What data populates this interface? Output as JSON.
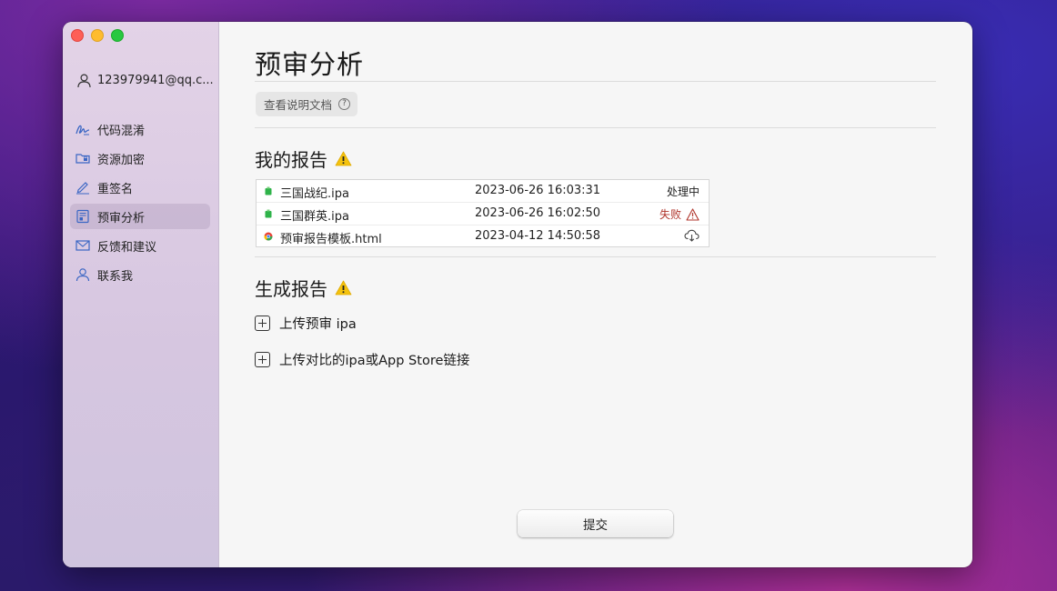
{
  "sidebar": {
    "account": "123979941@qq.c...",
    "items": [
      {
        "label": "代码混淆",
        "icon": "signature-icon"
      },
      {
        "label": "资源加密",
        "icon": "folder-lock-icon"
      },
      {
        "label": "重签名",
        "icon": "pencil-icon"
      },
      {
        "label": "预审分析",
        "icon": "document-icon",
        "active": true
      },
      {
        "label": "反馈和建议",
        "icon": "envelope-icon"
      },
      {
        "label": "联系我",
        "icon": "person-icon"
      }
    ]
  },
  "main": {
    "title": "预审分析",
    "doc_button": "查看说明文档",
    "help_glyph": "?",
    "my_reports": {
      "title": "我的报告",
      "rows": [
        {
          "name": "三国战纪.ipa",
          "date": "2023-06-26 16:03:31",
          "status": "处理中",
          "file_icon": "ipa-file-icon"
        },
        {
          "name": "三国群英.ipa",
          "date": "2023-06-26 16:02:50",
          "status": "失败",
          "file_icon": "ipa-file-icon"
        },
        {
          "name": "预审报告模板.html",
          "date": "2023-04-12 14:50:58",
          "status": "",
          "file_icon": "html-file-icon"
        }
      ]
    },
    "generate": {
      "title": "生成报告",
      "upload_ipa": "上传预审 ipa",
      "upload_compare": "上传对比的ipa或App Store链接"
    },
    "submit": "提交"
  },
  "colors": {
    "accent_nav_icon": "#3a66c4",
    "warning": "#f4c20d",
    "fail": "#b0352c"
  }
}
